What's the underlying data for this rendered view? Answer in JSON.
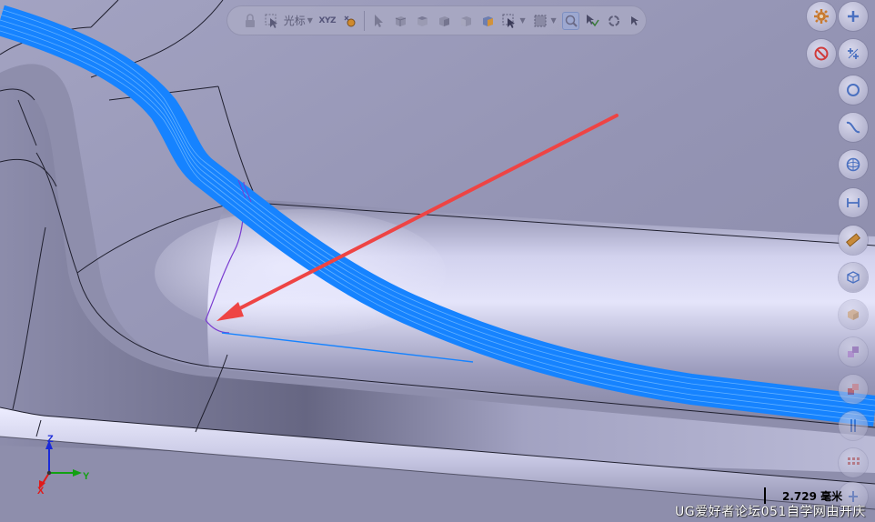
{
  "toolbar": {
    "cursor_label": "光标",
    "xyz_label": "XYZ",
    "icons": [
      "lock-icon",
      "select-cursor-icon",
      "xyz-icon",
      "snap-point-icon",
      "arrow-pointer-icon",
      "view-front-icon",
      "view-top-icon",
      "view-iso-icon",
      "view-shaded-icon",
      "select-box-icon",
      "marquee-icon",
      "zoom-fit-icon",
      "select-filter-icon",
      "rotate-view-icon",
      "undo-select-icon"
    ]
  },
  "right_tools": [
    "settings-icon",
    "plus-icon",
    "no-entry-icon",
    "point-cross-icon",
    "circle-icon",
    "curve-s-icon",
    "sphere-icon",
    "dimension-icon",
    "ruler-icon",
    "box-mesh-icon",
    "cube-solid-icon",
    "color-swatch-purple-icon",
    "color-swatch-red-icon",
    "plane-icon",
    "grid-dots-icon",
    "scale-bar-icon"
  ],
  "axes": {
    "x": "X",
    "y": "Y",
    "z": "Z"
  },
  "scale": {
    "value": "2.729 毫米"
  },
  "watermark": "UG爱好者论坛051自学网由开庆",
  "colors": {
    "surface": "#9696b6",
    "toolpath": "#1683ff",
    "arrow": "#ee4444",
    "edge": "#202030",
    "purple_curve": "#7a3cd0"
  }
}
